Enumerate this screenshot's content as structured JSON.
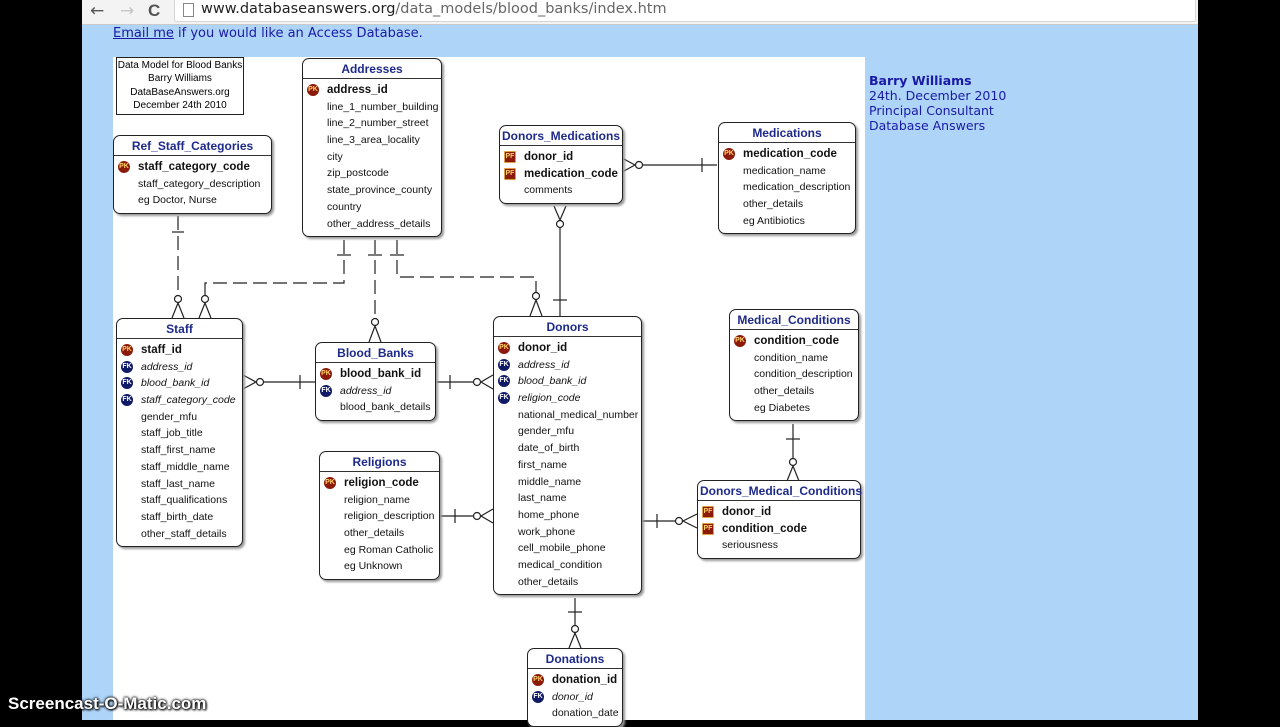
{
  "browser": {
    "nav": {
      "back_icon": "←",
      "forward_icon": "→",
      "reload_icon": "C"
    },
    "url_host": "www.databaseanswers.org",
    "url_path": "/data_models/blood_banks/index.htm"
  },
  "page": {
    "email_link": "Email me",
    "email_rest": " if you would like an Access Database.",
    "author": {
      "name": "Barry Williams",
      "date": "24th. December 2010",
      "role": "Principal Consultant",
      "company": "Database Answers"
    }
  },
  "diagram": {
    "note": [
      "Data Model for Blood Banks",
      "Barry Williams",
      "DataBaseAnswers.org",
      "December 24th 2010"
    ],
    "entities": {
      "ref_staff_categories": {
        "title": "Ref_Staff_Categories",
        "fields": [
          {
            "name": "staff_category_code",
            "key": "PK"
          },
          {
            "name": "staff_category_description",
            "key": ""
          },
          {
            "name": "eg Doctor, Nurse",
            "key": ""
          }
        ]
      },
      "addresses": {
        "title": "Addresses",
        "fields": [
          {
            "name": "address_id",
            "key": "PK"
          },
          {
            "name": "line_1_number_building",
            "key": ""
          },
          {
            "name": "line_2_number_street",
            "key": ""
          },
          {
            "name": "line_3_area_locality",
            "key": ""
          },
          {
            "name": "city",
            "key": ""
          },
          {
            "name": "zip_postcode",
            "key": ""
          },
          {
            "name": "state_province_county",
            "key": ""
          },
          {
            "name": "country",
            "key": ""
          },
          {
            "name": "other_address_details",
            "key": ""
          }
        ]
      },
      "donors_medications": {
        "title": "Donors_Medications",
        "fields": [
          {
            "name": "donor_id",
            "key": "PF"
          },
          {
            "name": "medication_code",
            "key": "PF"
          },
          {
            "name": "comments",
            "key": ""
          }
        ]
      },
      "medications": {
        "title": "Medications",
        "fields": [
          {
            "name": "medication_code",
            "key": "PK"
          },
          {
            "name": "medication_name",
            "key": ""
          },
          {
            "name": "medication_description",
            "key": ""
          },
          {
            "name": "other_details",
            "key": ""
          },
          {
            "name": "eg Antibiotics",
            "key": ""
          }
        ]
      },
      "staff": {
        "title": "Staff",
        "fields": [
          {
            "name": "staff_id",
            "key": "PK"
          },
          {
            "name": "address_id",
            "key": "FK"
          },
          {
            "name": "blood_bank_id",
            "key": "FK"
          },
          {
            "name": "staff_category_code",
            "key": "FK"
          },
          {
            "name": "gender_mfu",
            "key": ""
          },
          {
            "name": "staff_job_title",
            "key": ""
          },
          {
            "name": "staff_first_name",
            "key": ""
          },
          {
            "name": "staff_middle_name",
            "key": ""
          },
          {
            "name": "staff_last_name",
            "key": ""
          },
          {
            "name": "staff_qualifications",
            "key": ""
          },
          {
            "name": "staff_birth_date",
            "key": ""
          },
          {
            "name": "other_staff_details",
            "key": ""
          }
        ]
      },
      "blood_banks": {
        "title": "Blood_Banks",
        "fields": [
          {
            "name": "blood_bank_id",
            "key": "PK"
          },
          {
            "name": "address_id",
            "key": "FK"
          },
          {
            "name": "blood_bank_details",
            "key": ""
          }
        ]
      },
      "donors": {
        "title": "Donors",
        "fields": [
          {
            "name": "donor_id",
            "key": "PK"
          },
          {
            "name": "address_id",
            "key": "FK"
          },
          {
            "name": "blood_bank_id",
            "key": "FK"
          },
          {
            "name": "religion_code",
            "key": "FK"
          },
          {
            "name": "national_medical_number",
            "key": ""
          },
          {
            "name": "gender_mfu",
            "key": ""
          },
          {
            "name": "date_of_birth",
            "key": ""
          },
          {
            "name": "first_name",
            "key": ""
          },
          {
            "name": "middle_name",
            "key": ""
          },
          {
            "name": "last_name",
            "key": ""
          },
          {
            "name": "home_phone",
            "key": ""
          },
          {
            "name": "work_phone",
            "key": ""
          },
          {
            "name": "cell_mobile_phone",
            "key": ""
          },
          {
            "name": "medical_condition",
            "key": ""
          },
          {
            "name": "other_details",
            "key": ""
          }
        ]
      },
      "medical_conditions": {
        "title": "Medical_Conditions",
        "fields": [
          {
            "name": "condition_code",
            "key": "PK"
          },
          {
            "name": "condition_name",
            "key": ""
          },
          {
            "name": "condition_description",
            "key": ""
          },
          {
            "name": "other_details",
            "key": ""
          },
          {
            "name": "eg Diabetes",
            "key": ""
          }
        ]
      },
      "religions": {
        "title": "Religions",
        "fields": [
          {
            "name": "religion_code",
            "key": "PK"
          },
          {
            "name": "religion_name",
            "key": ""
          },
          {
            "name": "religion_description",
            "key": ""
          },
          {
            "name": "other_details",
            "key": ""
          },
          {
            "name": "eg Roman Catholic",
            "key": ""
          },
          {
            "name": "eg Unknown",
            "key": ""
          }
        ]
      },
      "donors_medical_conditions": {
        "title": "Donors_Medical_Conditions",
        "fields": [
          {
            "name": "donor_id",
            "key": "PF"
          },
          {
            "name": "condition_code",
            "key": "PF"
          },
          {
            "name": "seriousness",
            "key": ""
          }
        ]
      },
      "donations": {
        "title": "Donations",
        "fields": [
          {
            "name": "donation_id",
            "key": "PK"
          },
          {
            "name": "donor_id",
            "key": "FK"
          },
          {
            "name": "donation_date",
            "key": ""
          }
        ]
      }
    }
  },
  "watermark": "Screencast-O-Matic.com"
}
